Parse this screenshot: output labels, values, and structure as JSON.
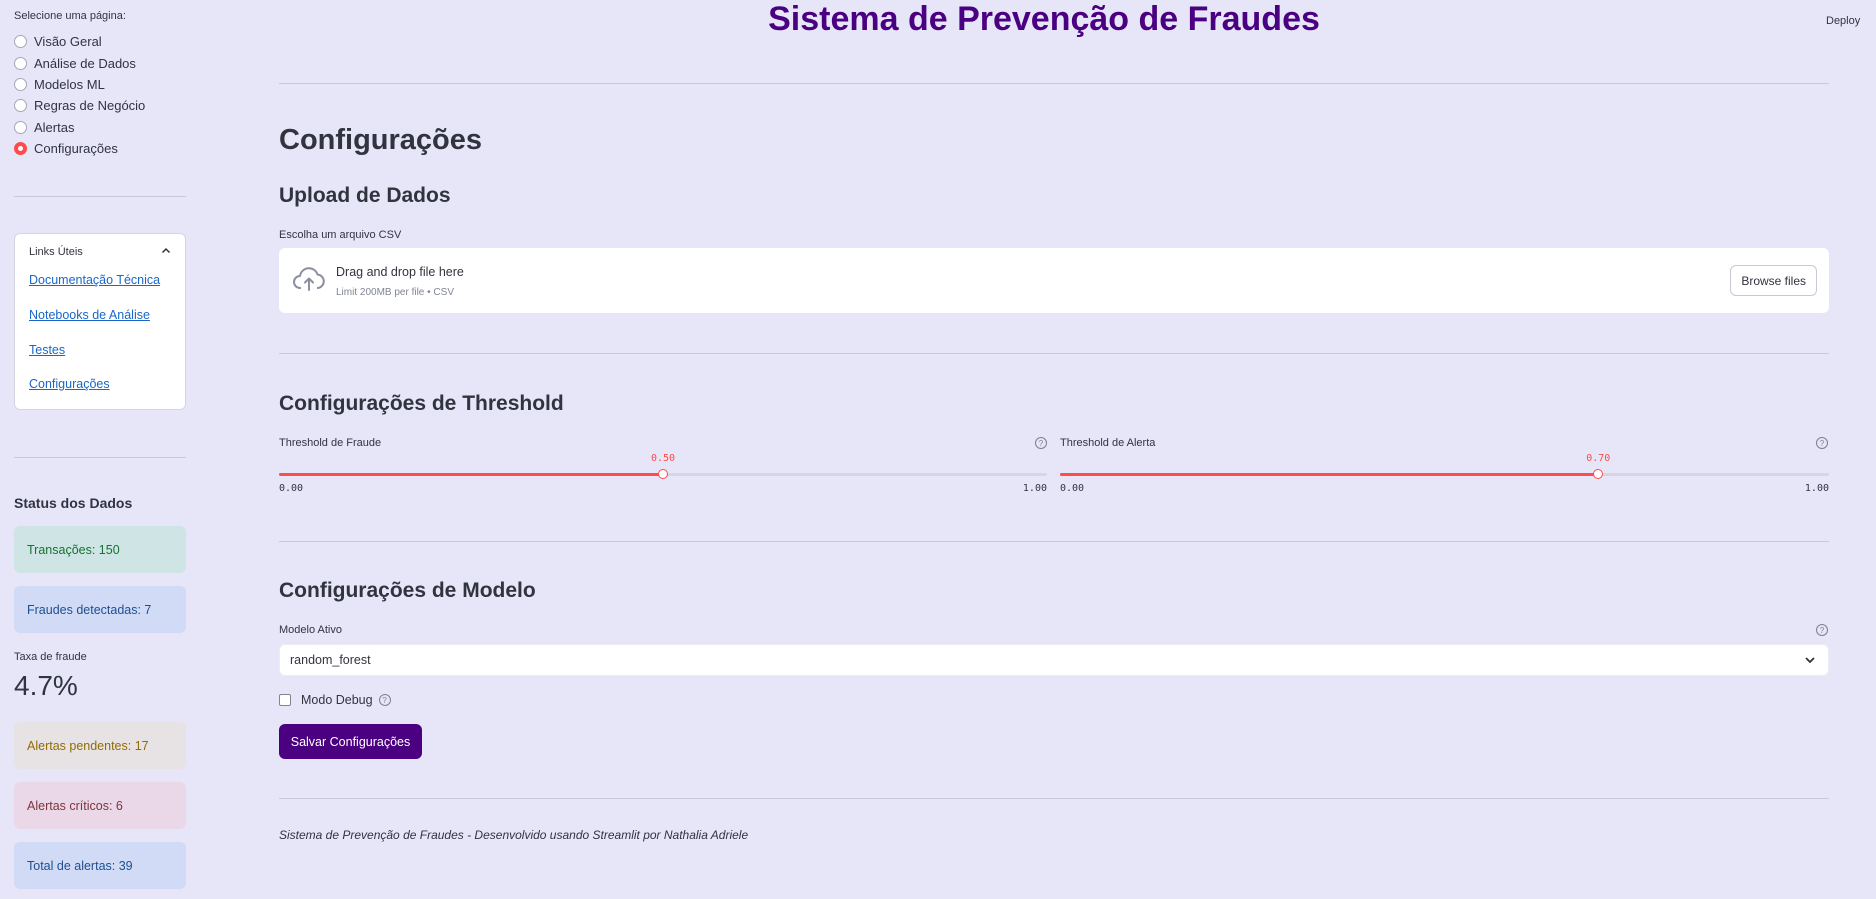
{
  "app": {
    "title": "Sistema de Prevenção de Fraudes",
    "deploy_label": "Deploy"
  },
  "sidebar": {
    "radio_caption": "Selecione uma página:",
    "pages": [
      {
        "label": "Visão Geral",
        "selected": false
      },
      {
        "label": "Análise de Dados",
        "selected": false
      },
      {
        "label": "Modelos ML",
        "selected": false
      },
      {
        "label": "Regras de Negócio",
        "selected": false
      },
      {
        "label": "Alertas",
        "selected": false
      },
      {
        "label": "Configurações",
        "selected": true
      }
    ],
    "links": {
      "title": "Links Úteis",
      "items": [
        "Documentação Técnica",
        "Notebooks de Análise",
        "Testes",
        "Configurações"
      ]
    },
    "status": {
      "title": "Status dos Dados",
      "transacoes": "Transações: 150",
      "fraudes": "Fraudes detectadas: 7",
      "taxa_label": "Taxa de fraude",
      "taxa_value": "4.7%",
      "alertas_pendentes": "Alertas pendentes: 17",
      "alertas_criticos": "Alertas críticos: 6",
      "total_alertas": "Total de alertas: 39"
    },
    "colors": {
      "success_bg": "#cfe4e4",
      "success_fg": "#177233",
      "info_bg": "#d2dbf6",
      "info_fg": "#1d4f91",
      "warning_bg": "#e7e3e4",
      "warning_fg": "#926c05",
      "error_bg": "#ead7e8",
      "error_fg": "#7d353b"
    }
  },
  "main": {
    "heading": "Configurações",
    "upload": {
      "title": "Upload de Dados",
      "label": "Escolha um arquivo CSV",
      "drop_title": "Drag and drop file here",
      "drop_sub": "Limit 200MB per file • CSV",
      "browse_label": "Browse files"
    },
    "threshold": {
      "title": "Configurações de Threshold",
      "fraude": {
        "label": "Threshold de Fraude",
        "value": 0.5,
        "value_label": "0.50",
        "min": "0.00",
        "max": "1.00"
      },
      "alerta": {
        "label": "Threshold de Alerta",
        "value": 0.7,
        "value_label": "0.70",
        "min": "0.00",
        "max": "1.00"
      }
    },
    "modelo": {
      "title": "Configurações de Modelo",
      "select_label": "Modelo Ativo",
      "select_value": "random_forest",
      "debug_label": "Modo Debug",
      "save_label": "Salvar Configurações"
    },
    "footer": "Sistema de Prevenção de Fraudes - Desenvolvido usando Streamlit por Nathalia Adriele"
  }
}
